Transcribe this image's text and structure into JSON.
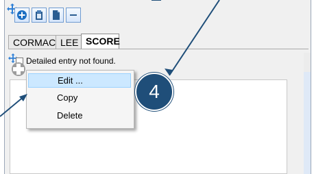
{
  "tabs": [
    {
      "label": "CORMACK",
      "active": false
    },
    {
      "label": "LEE",
      "active": false
    },
    {
      "label": "SCORE",
      "active": true
    }
  ],
  "message": "Detailed entry not found.",
  "context_menu": {
    "items": [
      {
        "label": "Edit ...",
        "highlighted": true
      },
      {
        "label": "Copy",
        "highlighted": false
      },
      {
        "label": "Delete",
        "highlighted": false
      }
    ]
  },
  "callout": {
    "number": "4",
    "color": "#1f4e79"
  },
  "toolbar": {
    "icons": [
      "move-icon",
      "add-circle-icon",
      "clipboard-icon",
      "document-icon",
      "minus-icon"
    ]
  },
  "colors": {
    "accent_blue": "#1f4e79",
    "menu_highlight": "#cce8ff",
    "window_bg": "#f0f0f0"
  }
}
